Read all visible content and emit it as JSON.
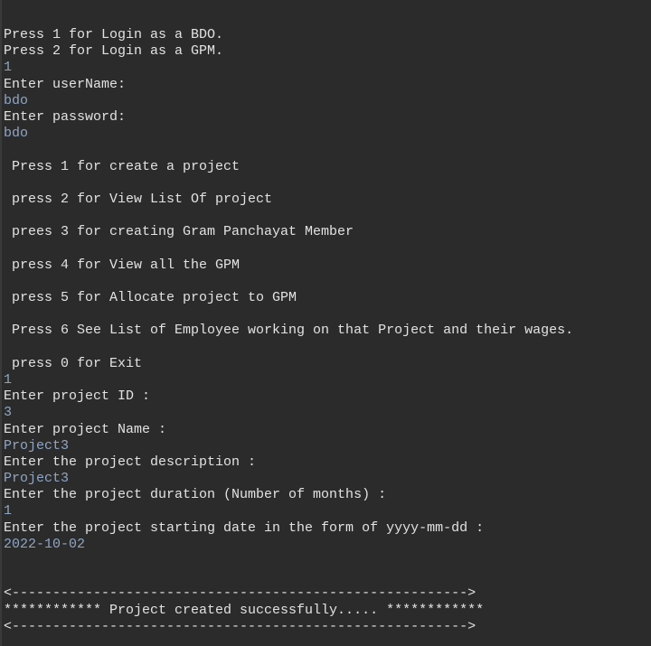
{
  "colors": {
    "background": "#2b2b2b",
    "output_text": "#e2e2e2",
    "input_text": "#8fa5c4"
  },
  "console": {
    "lines": [
      {
        "type": "output",
        "text": "Press 1 for Login as a BDO."
      },
      {
        "type": "output",
        "text": "Press 2 for Login as a GPM."
      },
      {
        "type": "input",
        "text": "1"
      },
      {
        "type": "output",
        "text": "Enter userName:"
      },
      {
        "type": "input",
        "text": "bdo"
      },
      {
        "type": "output",
        "text": "Enter password:"
      },
      {
        "type": "input",
        "text": "bdo"
      },
      {
        "type": "blank",
        "text": ""
      },
      {
        "type": "output",
        "text": " Press 1 for create a project"
      },
      {
        "type": "blank",
        "text": ""
      },
      {
        "type": "output",
        "text": " press 2 for View List Of project"
      },
      {
        "type": "blank",
        "text": ""
      },
      {
        "type": "output",
        "text": " prees 3 for creating Gram Panchayat Member"
      },
      {
        "type": "blank",
        "text": ""
      },
      {
        "type": "output",
        "text": " press 4 for View all the GPM"
      },
      {
        "type": "blank",
        "text": ""
      },
      {
        "type": "output",
        "text": " press 5 for Allocate project to GPM"
      },
      {
        "type": "blank",
        "text": ""
      },
      {
        "type": "output",
        "text": " Press 6 See List of Employee working on that Project and their wages."
      },
      {
        "type": "blank",
        "text": ""
      },
      {
        "type": "output",
        "text": " press 0 for Exit"
      },
      {
        "type": "input",
        "text": "1"
      },
      {
        "type": "output",
        "text": "Enter project ID :"
      },
      {
        "type": "input",
        "text": "3"
      },
      {
        "type": "output",
        "text": "Enter project Name :"
      },
      {
        "type": "input",
        "text": "Project3"
      },
      {
        "type": "output",
        "text": "Enter the project description :"
      },
      {
        "type": "input",
        "text": "Project3"
      },
      {
        "type": "output",
        "text": "Enter the project duration (Number of months) :"
      },
      {
        "type": "input",
        "text": "1"
      },
      {
        "type": "output",
        "text": "Enter the project starting date in the form of yyyy-mm-dd :"
      },
      {
        "type": "input",
        "text": "2022-10-02"
      },
      {
        "type": "blank",
        "text": ""
      },
      {
        "type": "blank",
        "text": ""
      },
      {
        "type": "output",
        "text": "<-------------------------------------------------------->"
      },
      {
        "type": "output",
        "text": "************ Project created successfully..... ************"
      },
      {
        "type": "output",
        "text": "<-------------------------------------------------------->"
      }
    ]
  }
}
